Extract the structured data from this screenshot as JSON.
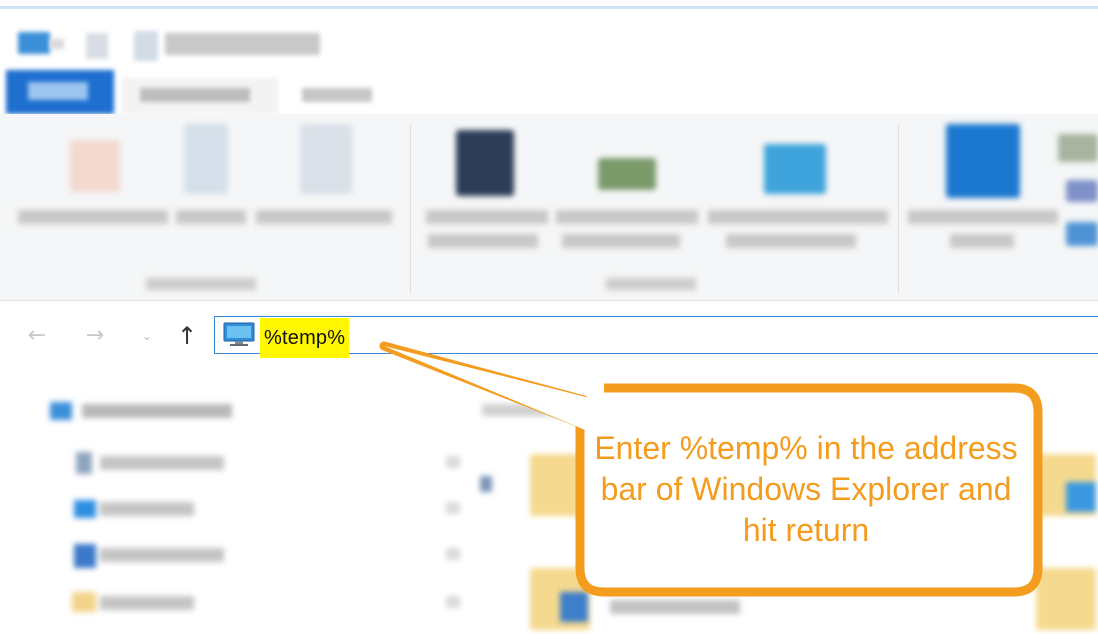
{
  "address_bar": {
    "value": "%temp%"
  },
  "callout": {
    "text": "Enter %temp% in the address bar of Windows Explorer and hit return"
  },
  "nav": {
    "back_icon": "←",
    "forward_icon": "→",
    "recent_icon": "⌄",
    "up_icon": "↑"
  },
  "colors": {
    "highlight": "#fff700",
    "callout_orange": "#f39c1e",
    "address_border": "#3b8ad9",
    "file_tab": "#1e6fd0"
  },
  "icons": [
    "back-arrow-icon",
    "forward-arrow-icon",
    "recent-locations-icon",
    "up-arrow-icon",
    "this-pc-icon",
    "folder-icon",
    "quick-access-star-icon",
    "pin-icon"
  ]
}
